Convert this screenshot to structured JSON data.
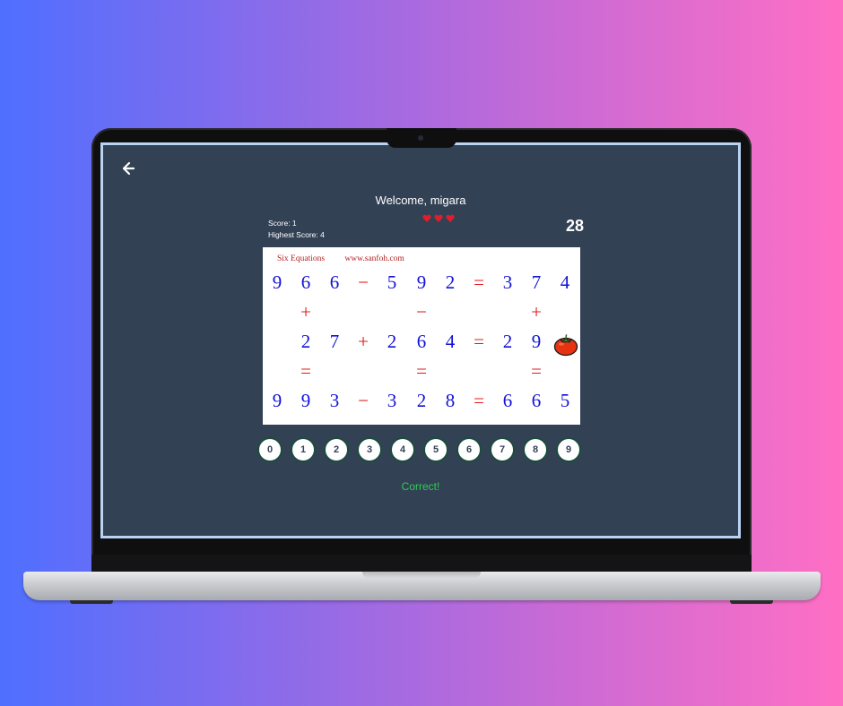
{
  "app": {
    "welcome_text": "Welcome, migara",
    "score_text": "Score: 1",
    "highest_score_text": "Highest Score: 4",
    "lives": 3,
    "timer": "28",
    "feedback": "Correct!"
  },
  "puzzle": {
    "title": "Six Equations",
    "site": "www.sanfoh.com",
    "rows": [
      [
        "9",
        "6",
        "6",
        "−",
        "5",
        "9",
        "2",
        "=",
        "3",
        "7",
        "4"
      ],
      [
        "",
        "+",
        "",
        "",
        "",
        "−",
        "",
        "",
        "",
        "+",
        ""
      ],
      [
        "",
        "2",
        "7",
        "+",
        "2",
        "6",
        "4",
        "=",
        "2",
        "9",
        ""
      ],
      [
        "",
        "=",
        "",
        "",
        "",
        "=",
        "",
        "",
        "",
        "=",
        ""
      ],
      [
        "9",
        "9",
        "3",
        "−",
        "3",
        "2",
        "8",
        "=",
        "6",
        "6",
        "5"
      ]
    ],
    "tomato_icon": "tomato-icon"
  },
  "numpad": [
    "0",
    "1",
    "2",
    "3",
    "4",
    "5",
    "6",
    "7",
    "8",
    "9"
  ],
  "icons": {
    "back": "arrow-left-icon",
    "heart": "heart-icon"
  },
  "colors": {
    "screen_bg": "#334155",
    "digit": "#1212d8",
    "operator": "#e01818",
    "heart": "#e11d2a",
    "feedback": "#2ecc55",
    "button_border": "#1a4d3c"
  }
}
